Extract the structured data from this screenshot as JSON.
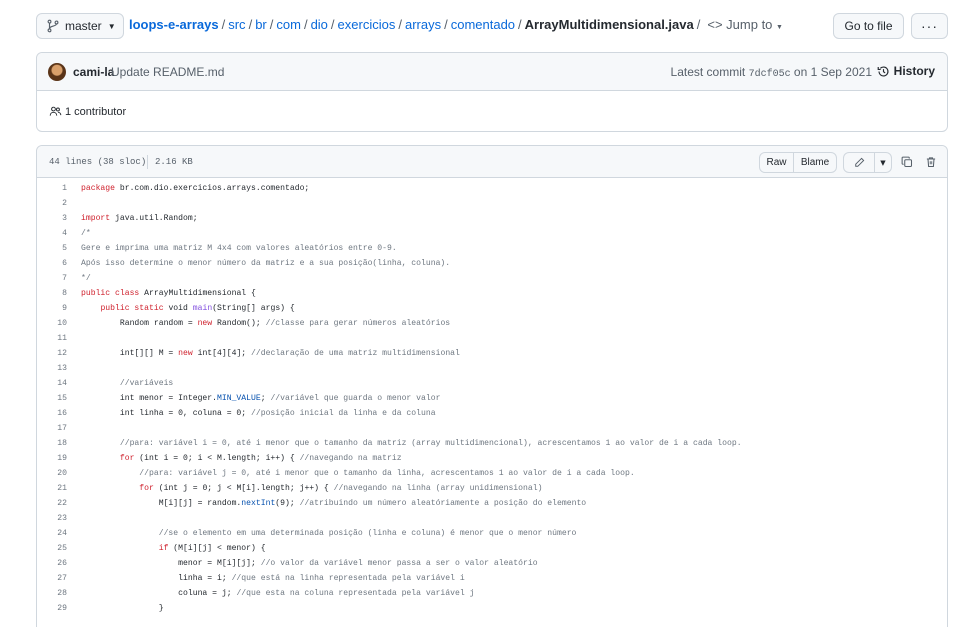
{
  "topbar": {
    "branch": "master",
    "breadcrumb": {
      "repo": "loops-e-arrays",
      "parts": [
        "src",
        "br",
        "com",
        "dio",
        "exercicios",
        "arrays",
        "comentado"
      ],
      "file": "ArrayMultidimensional.java",
      "jump": "Jump to"
    },
    "goto_file": "Go to file",
    "more": "···"
  },
  "commit": {
    "author": "cami-la",
    "message": "Update README.md",
    "latest_label": "Latest commit",
    "sha": "7dcf05c",
    "date": "on 1 Sep 2021",
    "history": "History",
    "contributors": "1 contributor"
  },
  "file": {
    "lines_info": "44 lines (38 sloc)",
    "size": "2.16 KB",
    "raw": "Raw",
    "blame": "Blame"
  },
  "code_lines": [
    [
      {
        "t": "package",
        "k": "k"
      },
      {
        "t": " br.com.dio.exercicios.arrays.comentado;"
      }
    ],
    [],
    [
      {
        "t": "import",
        "k": "k"
      },
      {
        "t": " java.util.Random;"
      }
    ],
    [
      {
        "t": "/*",
        "k": "c"
      }
    ],
    [
      {
        "t": "Gere e imprima uma matriz M 4x4 com valores aleatórios entre 0-9.",
        "k": "c"
      }
    ],
    [
      {
        "t": "Após isso determine o menor número da matriz e a sua posição(linha, coluna).",
        "k": "c"
      }
    ],
    [
      {
        "t": "*/",
        "k": "c"
      }
    ],
    [
      {
        "t": "public class",
        "k": "k"
      },
      {
        "t": " ArrayMultidimensional {"
      }
    ],
    [
      {
        "t": "    "
      },
      {
        "t": "public static",
        "k": "k"
      },
      {
        "t": " void "
      },
      {
        "t": "main",
        "k": "f"
      },
      {
        "t": "(String[] args) {"
      }
    ],
    [
      {
        "t": "        Random random = "
      },
      {
        "t": "new",
        "k": "k"
      },
      {
        "t": " Random(); "
      },
      {
        "t": "//classe para gerar números aleatórios",
        "k": "c"
      }
    ],
    [],
    [
      {
        "t": "        int[][] M = "
      },
      {
        "t": "new",
        "k": "k"
      },
      {
        "t": " int[4][4]; "
      },
      {
        "t": "//declaração de uma matriz multidimensional",
        "k": "c"
      }
    ],
    [],
    [
      {
        "t": "        //variáveis",
        "k": "c"
      }
    ],
    [
      {
        "t": "        int menor = Integer."
      },
      {
        "t": "MIN_VALUE",
        "k": "n"
      },
      {
        "t": "; "
      },
      {
        "t": "//variável que guarda o menor valor",
        "k": "c"
      }
    ],
    [
      {
        "t": "        int linha = 0, coluna = 0; "
      },
      {
        "t": "//posição inicial da linha e da coluna",
        "k": "c"
      }
    ],
    [],
    [
      {
        "t": "        //para: variável i = 0, até i menor que o tamanho da matriz (array multidimencional), acrescentamos 1 ao valor de i a cada loop.",
        "k": "c"
      }
    ],
    [
      {
        "t": "        "
      },
      {
        "t": "for",
        "k": "k"
      },
      {
        "t": " (int i = 0; i < M.length; i++) { "
      },
      {
        "t": "//navegando na matriz",
        "k": "c"
      }
    ],
    [
      {
        "t": "            //para: variável j = 0, até i menor que o tamanho da linha, acrescentamos 1 ao valor de i a cada loop.",
        "k": "c"
      }
    ],
    [
      {
        "t": "            "
      },
      {
        "t": "for",
        "k": "k"
      },
      {
        "t": " (int j = 0; j < M[i].length; j++) { "
      },
      {
        "t": "//navegando na linha (array unidimensional)",
        "k": "c"
      }
    ],
    [
      {
        "t": "                M[i][j] = random."
      },
      {
        "t": "nextInt",
        "k": "n"
      },
      {
        "t": "(9); "
      },
      {
        "t": "//atribuindo um número aleatóriamente a posição do elemento",
        "k": "c"
      }
    ],
    [],
    [
      {
        "t": "                //se o elemento em uma determinada posição (linha e coluna) é menor que o menor número",
        "k": "c"
      }
    ],
    [
      {
        "t": "                "
      },
      {
        "t": "if",
        "k": "k"
      },
      {
        "t": " (M[i][j] < menor) {"
      }
    ],
    [
      {
        "t": "                    menor = M[i][j]; "
      },
      {
        "t": "//o valor da variável menor passa a ser o valor aleatório",
        "k": "c"
      }
    ],
    [
      {
        "t": "                    linha = i; "
      },
      {
        "t": "//que está na linha representada pela variável i",
        "k": "c"
      }
    ],
    [
      {
        "t": "                    coluna = j; "
      },
      {
        "t": "//que esta na coluna representada pela variável j",
        "k": "c"
      }
    ],
    [
      {
        "t": "                }"
      }
    ]
  ]
}
